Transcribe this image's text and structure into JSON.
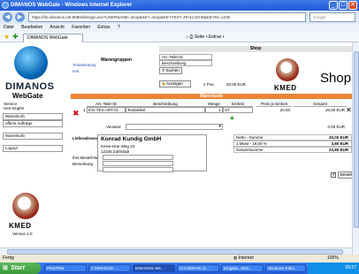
{
  "window": {
    "title": "DIMANOS WebGate - Windows Internet Explorer"
  },
  "address": {
    "url": "https://hb-dimanos.net:8080/dielogin.exe?USERNAME=shop&KEY=shop&KEYTEXT=RH1LOGIN&KEYID=1236",
    "cert_label": "Zertifikatfehler",
    "search_placeholder": "Google"
  },
  "menu": [
    "Datei",
    "Bearbeiten",
    "Ansicht",
    "Favoriten",
    "Extras",
    "?"
  ],
  "tab": {
    "label": "DIMANOS WebGate"
  },
  "toolbar": {
    "tools_text": "Seite ▾   Extras ▾"
  },
  "sidebar": {
    "logo_text": "DIMANOS",
    "app_title": "WebGate",
    "service_label": "Service:",
    "user_label": "Herr Düpfer",
    "links": [
      "Warenkorb",
      "offene Aufträge",
      "Warenkorb",
      "Logout"
    ],
    "version": "Version 1.0",
    "kmed": "KMED"
  },
  "main": {
    "shop_header": "Shop",
    "warengruppen_label": "Warengruppen",
    "testanleitung": "Testanleitung",
    "test": "test",
    "artid_placeholder": "Art.-Teile-ID",
    "beschreibung_placeholder": "Beschreibung",
    "suchen_label": "Suchen",
    "anzeigen_label": "Anzeigen",
    "pos_count": "1 Pos.",
    "pos_total": "20,00 EUR",
    "kmed": "KMED",
    "shop_word": "Shop",
    "warenkorb_header": "Warenkorb"
  },
  "cart": {
    "columns": [
      "Art.-Teile-ID",
      "Beschreibung",
      "Menge",
      "Einheit",
      "Preis je Einheit",
      "Gesamt"
    ],
    "rows": [
      {
        "nr": "1",
        "artid": "EXI-TES-ART-01",
        "desc": "Testartikel",
        "qty": "1",
        "unit": "ST",
        "price": "20,00",
        "total": "20,00 EUR"
      }
    ],
    "versand_label": "Versand",
    "versand_total": "0,00 EUR"
  },
  "delivery": {
    "label": "Lieferadresse",
    "company": "Konrad Kundig GmbH",
    "street": "Keine-Hüe-Weg 23",
    "city": "12345 Zahlstadt",
    "order_no_label": "Ihre Bestell-Nr.",
    "remark_label": "Bemerkung"
  },
  "sums": [
    {
      "label": "Netto - Summe",
      "value": "20,00 EUR"
    },
    {
      "label": "1.Mwst - 19,00 %",
      "value": "3,80 EUR"
    },
    {
      "label": "Gesamtsumme",
      "value": "23,80 EUR"
    }
  ],
  "order_button": "Bestellen",
  "status": {
    "left": "Fertig",
    "internet": "Internet",
    "zoom": "100%"
  },
  "taskbar": {
    "start": "Start",
    "tasks": [
      "PKD/Pilot",
      "2 DIMANOS-...",
      "DIMANOS We...",
      "CorelDRAW 11...",
      "Eingabe, Start...",
      "Windows-Edito..."
    ],
    "clock": "09:27"
  }
}
